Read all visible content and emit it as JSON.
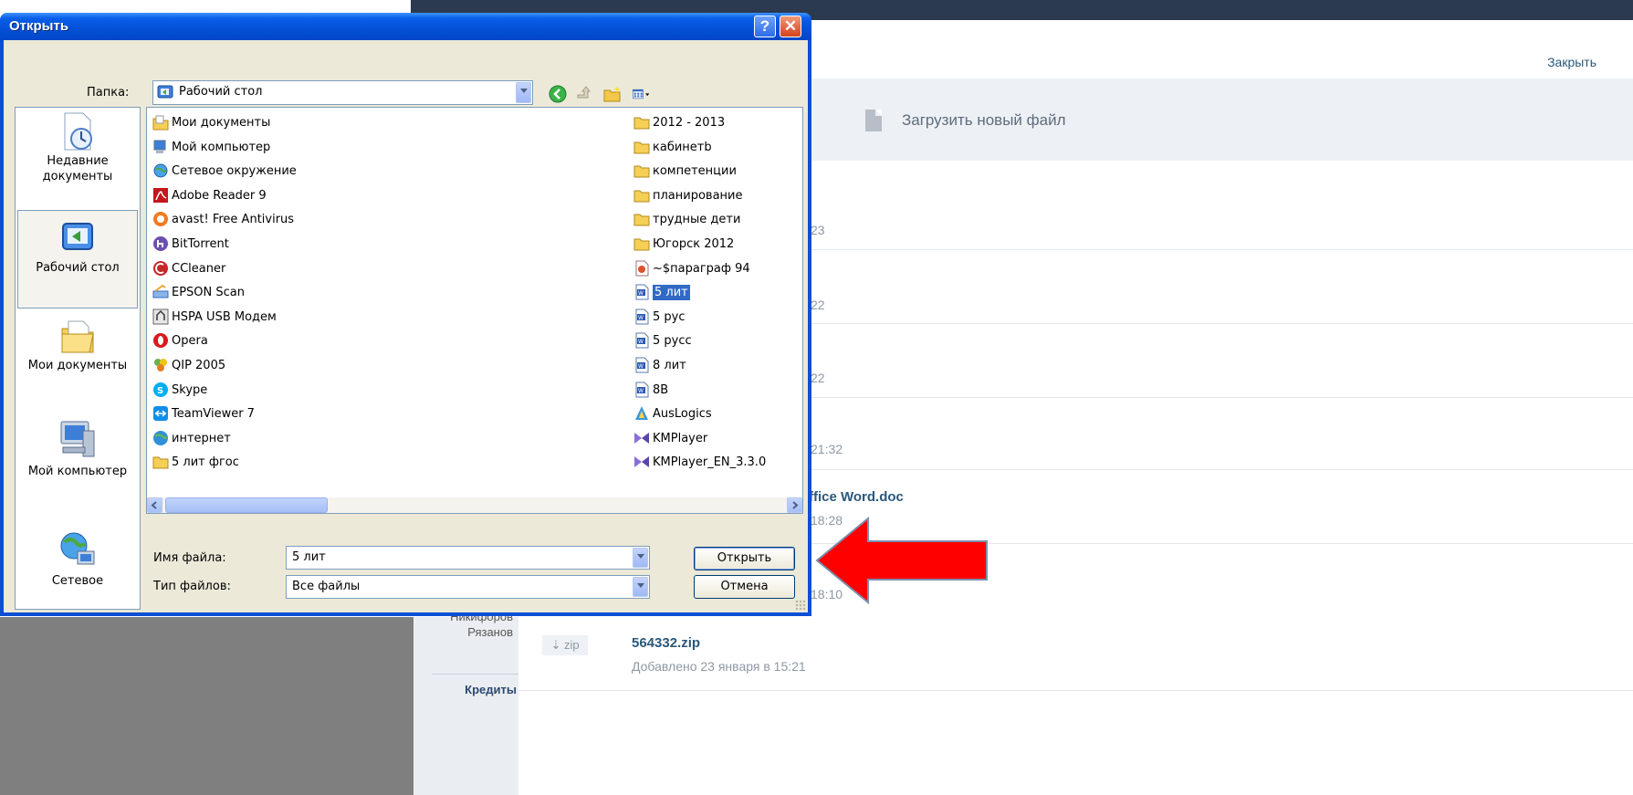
{
  "dialog": {
    "title": "Открыть",
    "help_glyph": "?",
    "close_glyph": "✕",
    "folder_label": "Папка:",
    "folder_value": "Рабочий стол",
    "filename_label": "Имя файла:",
    "filename_value": "5 лит",
    "filetype_label": "Тип файлов:",
    "filetype_value": "Все файлы",
    "open_button": "Открыть",
    "cancel_button": "Отмена",
    "places": [
      {
        "label": "Недавние документы",
        "icon": "recent-documents-icon"
      },
      {
        "label": "Рабочий стол",
        "icon": "desktop-icon"
      },
      {
        "label": "Мои документы",
        "icon": "my-documents-icon"
      },
      {
        "label": "Мой компьютер",
        "icon": "my-computer-icon"
      },
      {
        "label": "Сетевое",
        "icon": "network-icon"
      }
    ],
    "files_col1": [
      {
        "name": "Мои документы",
        "icon": "my-documents-icon"
      },
      {
        "name": "Мой компьютер",
        "icon": "my-computer-icon"
      },
      {
        "name": "Сетевое окружение",
        "icon": "network-icon"
      },
      {
        "name": "Adobe Reader 9",
        "icon": "adobe-reader-icon"
      },
      {
        "name": "avast! Free Antivirus",
        "icon": "avast-icon"
      },
      {
        "name": "BitTorrent",
        "icon": "bittorrent-icon"
      },
      {
        "name": "CCleaner",
        "icon": "ccleaner-icon"
      },
      {
        "name": "EPSON Scan",
        "icon": "epson-scan-icon"
      },
      {
        "name": "HSPA USB Модем",
        "icon": "modem-icon"
      },
      {
        "name": "Opera",
        "icon": "opera-icon"
      },
      {
        "name": "QIP 2005",
        "icon": "qip-icon"
      },
      {
        "name": "Skype",
        "icon": "skype-icon"
      },
      {
        "name": "TeamViewer 7",
        "icon": "teamviewer-icon"
      },
      {
        "name": "интернет",
        "icon": "internet-icon"
      },
      {
        "name": "5 лит фгос",
        "icon": "folder-icon"
      }
    ],
    "files_col2": [
      {
        "name": "2012 - 2013",
        "icon": "folder-icon"
      },
      {
        "name": "кабинетb",
        "icon": "folder-icon"
      },
      {
        "name": "компетенции",
        "icon": "folder-icon"
      },
      {
        "name": "планирование",
        "icon": "folder-icon"
      },
      {
        "name": "трудные дети",
        "icon": "folder-icon"
      },
      {
        "name": "Югорск 2012",
        "icon": "folder-icon"
      },
      {
        "name": "~$параграф 94",
        "icon": "powerpoint-file-icon"
      },
      {
        "name": "5 лит",
        "icon": "word-file-icon",
        "selected": true
      },
      {
        "name": "5 рус",
        "icon": "word-file-icon"
      },
      {
        "name": "5 русс",
        "icon": "word-file-icon"
      },
      {
        "name": "8 лит",
        "icon": "word-file-icon"
      },
      {
        "name": "8В",
        "icon": "word-file-icon"
      },
      {
        "name": "AusLogics",
        "icon": "auslogics-icon"
      },
      {
        "name": "KMPlayer",
        "icon": "kmplayer-icon"
      },
      {
        "name": "KMPlayer_EN_3.3.0",
        "icon": "kmplayer-icon"
      }
    ]
  },
  "background": {
    "close_link": "Закрыть",
    "upload_label": "Загрузить новый файл",
    "row_times": [
      "23",
      "22",
      "22",
      "21:32",
      "18:28",
      "18:10"
    ],
    "row_file_title": "ffice Word.doc",
    "left_names": [
      "Никифоров",
      "Рязанов"
    ],
    "credits_label": "Кредиты",
    "zip_badge": "⇣ zip",
    "zip_name": "564332.zip",
    "zip_meta": "Добавлено 23 января в 15:21"
  },
  "colors": {
    "xp_blue": "#0450d6",
    "dialog_bg": "#ece9d8",
    "selection": "#316ac5",
    "arrow_red": "#ff0000",
    "link_blue": "#2b587a"
  }
}
